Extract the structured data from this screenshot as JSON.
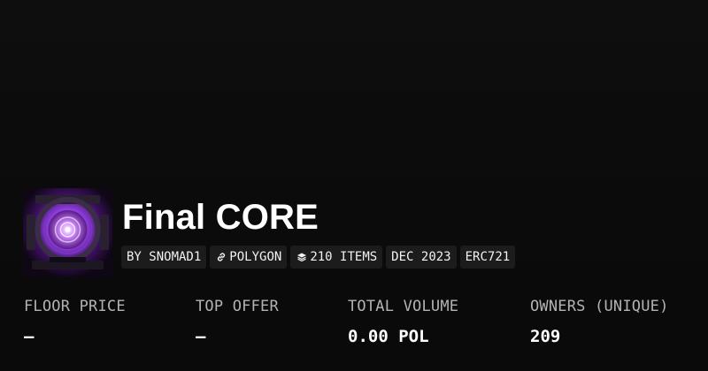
{
  "collection": {
    "name": "Final CORE",
    "avatar_icon": "core-artwork-image"
  },
  "tags": [
    {
      "label": "BY SNOMAD1",
      "icon": ""
    },
    {
      "label": "POLYGON",
      "icon": "link-icon"
    },
    {
      "label": "210 ITEMS",
      "icon": "layers-icon"
    },
    {
      "label": "DEC 2023",
      "icon": ""
    },
    {
      "label": "ERC721",
      "icon": ""
    }
  ],
  "stats": [
    {
      "label": "FLOOR PRICE",
      "value": "—"
    },
    {
      "label": "TOP OFFER",
      "value": "—"
    },
    {
      "label": "TOTAL VOLUME",
      "value": "0.00 POL"
    },
    {
      "label": "OWNERS (UNIQUE)",
      "value": "209"
    }
  ],
  "colors": {
    "background": "#0b0b0b",
    "tag_background": "#1c1c1c",
    "label_text": "#b3b3b3",
    "accent_purple": "#a64dff"
  }
}
